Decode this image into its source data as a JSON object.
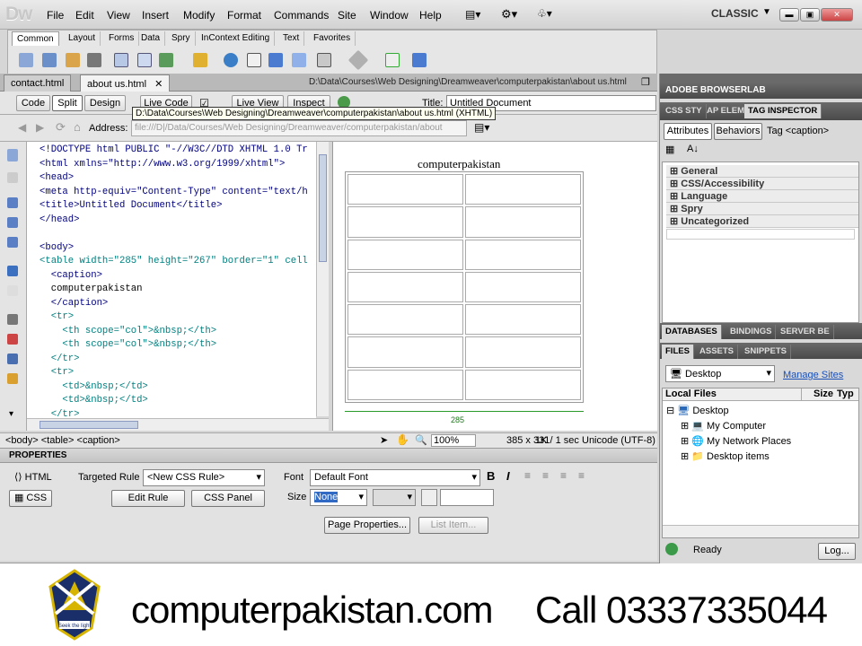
{
  "app": {
    "logo": "Dw",
    "workspace": "CLASSIC"
  },
  "menu": [
    "File",
    "Edit",
    "View",
    "Insert",
    "Modify",
    "Format",
    "Commands",
    "Site",
    "Window",
    "Help"
  ],
  "insert_tabs": [
    "Common",
    "Layout",
    "Forms",
    "Data",
    "Spry",
    "InContext Editing",
    "Text",
    "Favorites"
  ],
  "doc_tabs": [
    {
      "label": "contact.html"
    },
    {
      "label": "about us.html"
    }
  ],
  "doc_path": "D:\\Data\\Courses\\Web Designing\\Dreamweaver\\computerpakistan\\about us.html",
  "toolbar": {
    "code": "Code",
    "split": "Split",
    "design": "Design",
    "live_code": "Live Code",
    "live_view": "Live View",
    "inspect": "Inspect",
    "title_label": "Title:",
    "title_value": "Untitled Document"
  },
  "address": {
    "label": "Address:",
    "value": "file:///D|/Data/Courses/Web Designing/Dreamweaver/computerpakistan/about"
  },
  "tooltip": "D:\\Data\\Courses\\Web Designing\\Dreamweaver\\computerpakistan\\about us.html (XHTML)",
  "code_lines": [
    "<!DOCTYPE html PUBLIC \"-//W3C//DTD XHTML 1.0 Tr",
    "<html xmlns=\"http://www.w3.org/1999/xhtml\">",
    "<head>",
    "<meta http-equiv=\"Content-Type\" content=\"text/h",
    "<title>Untitled Document</title>",
    "</head>",
    "",
    "<body>",
    "<table width=\"285\" height=\"267\" border=\"1\" cell",
    "  <caption>",
    "  computerpakistan",
    "  </caption>",
    "  <tr>",
    "    <th scope=\"col\">&nbsp;</th>",
    "    <th scope=\"col\">&nbsp;</th>",
    "  </tr>",
    "  <tr>",
    "    <td>&nbsp;</td>",
    "    <td>&nbsp;</td>",
    "  </tr>"
  ],
  "design": {
    "caption": "computerpakistan",
    "width_label": "285"
  },
  "status": {
    "tags": "<body> <table> <caption>",
    "zoom": "100%",
    "size": "385 x 331",
    "download": "1K / 1 sec",
    "encoding": "Unicode (UTF-8)"
  },
  "properties": {
    "header": "PROPERTIES",
    "html": "HTML",
    "css": "CSS",
    "targeted_rule_label": "Targeted Rule",
    "targeted_rule_value": "<New CSS Rule>",
    "edit_rule": "Edit Rule",
    "css_panel": "CSS Panel",
    "font_label": "Font",
    "font_value": "Default Font",
    "size_label": "Size",
    "size_value": "None",
    "page_properties": "Page Properties...",
    "list_item": "List Item..."
  },
  "browserlab": "ADOBE BROWSERLAB",
  "css_tabs": [
    "CSS STY",
    "AP ELEM",
    "TAG INSPECTOR"
  ],
  "tag_inspector": {
    "attributes": "Attributes",
    "behaviors": "Behaviors",
    "tag": "Tag <caption>",
    "categories": [
      "General",
      "CSS/Accessibility",
      "Language",
      "Spry",
      "Uncategorized"
    ]
  },
  "db_tabs": [
    "DATABASES",
    "BINDINGS",
    "SERVER BE"
  ],
  "files_tabs": [
    "FILES",
    "ASSETS",
    "SNIPPETS"
  ],
  "files": {
    "site": "Desktop",
    "manage": "Manage Sites",
    "col_local": "Local Files",
    "col_size": "Size",
    "col_type": "Typ",
    "tree": [
      {
        "label": "Desktop",
        "level": 0
      },
      {
        "label": "My Computer",
        "level": 1
      },
      {
        "label": "My Network Places",
        "level": 1
      },
      {
        "label": "Desktop items",
        "level": 1
      }
    ],
    "ready": "Ready",
    "log": "Log..."
  },
  "banner": {
    "site": "computerpakistan.com",
    "call": "Call 03337335044",
    "logo_text": "Seek the light"
  }
}
